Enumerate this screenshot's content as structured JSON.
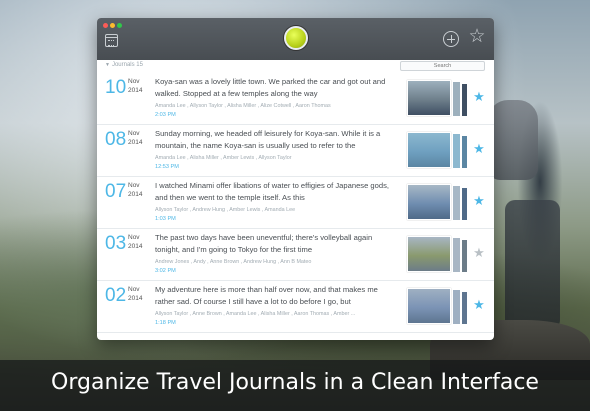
{
  "app": {
    "section_label": "Journals 15",
    "search_placeholder": "Search"
  },
  "toolbar": {
    "calendar_icon": "calendar-icon",
    "logo_icon": "app-logo",
    "add_icon": "add-circle-icon",
    "favorites_icon": "star-icon"
  },
  "entries": [
    {
      "day": "10",
      "month": "Nov",
      "year": "2014",
      "text": "Koya-san was a lovely little town. We parked the car and got out and walked. Stopped at a few temples along the way",
      "people": "Amanda Lee , Allyson Taylor , Alisha Miller , Alize Cotwell , Aaron Thomas",
      "time": "2:03 PM",
      "starred": true,
      "thumb_colors": [
        "#6e7f8b",
        "#9db0bd",
        "#3f4f63"
      ]
    },
    {
      "day": "08",
      "month": "Nov",
      "year": "2014",
      "text": "Sunday morning, we headed off leisurely for Koya-san. While it is a mountain, the name Koya-san is usually used to refer to the",
      "people": "Amanda Lee , Alisha Miller , Amber Lewis , Allyson Taylor",
      "time": "12:53 PM",
      "starred": true,
      "thumb_colors": [
        "#6fa0c0",
        "#8cb8cf",
        "#5b86a3"
      ]
    },
    {
      "day": "07",
      "month": "Nov",
      "year": "2014",
      "text": "I watched Minami offer libations of water to effigies of Japanese gods, and then we went to the temple itself. As this",
      "people": "Allyson Taylor , Andrew Hung , Amber Lewis , Amanda Lee",
      "time": "1:03 PM",
      "starred": true,
      "thumb_colors": [
        "#6f8db0",
        "#a7b8c6",
        "#4f6a88"
      ]
    },
    {
      "day": "03",
      "month": "Nov",
      "year": "2014",
      "text": "The past two days have been uneventful; there's volleyball again tonight, and I'm going to Tokyo for the first time",
      "people": "Andrew Jones , Andy , Anne Brown , Andrew Hung , Ann B Mateo",
      "time": "3:02 PM",
      "starred": false,
      "thumb_colors": [
        "#8a9a6e",
        "#a8b6c4",
        "#6c7c88"
      ]
    },
    {
      "day": "02",
      "month": "Nov",
      "year": "2014",
      "text": "My adventure here is more than half over now, and that makes me rather sad. Of course I still have a lot to do before I go, but",
      "people": "Allyson Taylor , Anne Brown , Amanda Lee , Alisha Miller , Aaron Thomas , Amber ...",
      "time": "1:18 PM",
      "starred": true,
      "thumb_colors": [
        "#7b93b5",
        "#9fb0c2",
        "#5e7590"
      ]
    }
  ],
  "colors": {
    "accent": "#4db7e6",
    "star_on": "#4db7e6",
    "star_off": "#b9c0c5",
    "titlebar": "#4e5358"
  },
  "caption": "Organize Travel Journals in a Clean Interface"
}
